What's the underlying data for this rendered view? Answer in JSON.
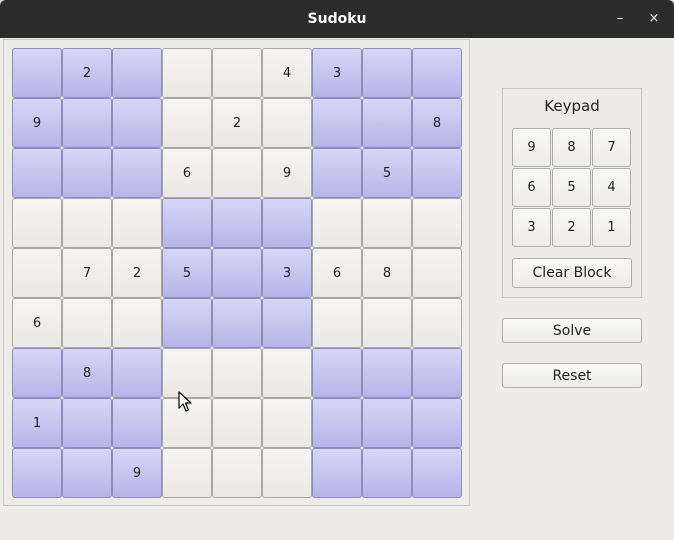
{
  "window": {
    "title": "Sudoku",
    "minimize_label": "–",
    "close_label": "×"
  },
  "colors": {
    "shaded_cell": "#c5c3f0",
    "plain_cell": "#f2f1ef",
    "titlebar": "#2c2c2c"
  },
  "board": {
    "rows": [
      [
        "",
        "2",
        "",
        "",
        "",
        "4",
        "3",
        "",
        ""
      ],
      [
        "9",
        "",
        "",
        "",
        "2",
        "",
        "",
        "",
        "8"
      ],
      [
        "",
        "",
        "",
        "6",
        "",
        "9",
        "",
        "5",
        ""
      ],
      [
        "",
        "",
        "",
        "",
        "",
        "",
        "",
        "",
        ""
      ],
      [
        "",
        "7",
        "2",
        "5",
        "",
        "3",
        "6",
        "8",
        ""
      ],
      [
        "6",
        "",
        "",
        "",
        "",
        "",
        "",
        "",
        ""
      ],
      [
        "",
        "8",
        "",
        "",
        "",
        "",
        "",
        "",
        ""
      ],
      [
        "1",
        "",
        "",
        "",
        "",
        "",
        "",
        "",
        ""
      ],
      [
        "",
        "",
        "9",
        "",
        "",
        "",
        "",
        "",
        ""
      ]
    ]
  },
  "keypad": {
    "title": "Keypad",
    "keys": [
      "9",
      "8",
      "7",
      "6",
      "5",
      "4",
      "3",
      "2",
      "1"
    ],
    "clear_label": "Clear Block"
  },
  "actions": {
    "solve_label": "Solve",
    "reset_label": "Reset"
  }
}
